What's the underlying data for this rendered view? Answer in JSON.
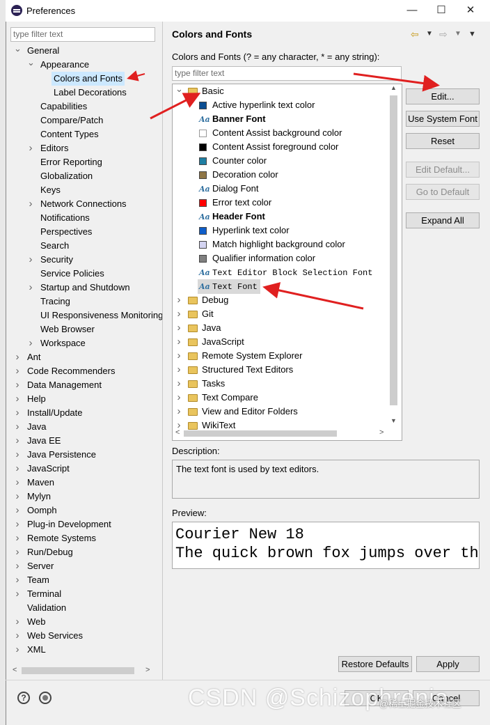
{
  "window": {
    "title": "Preferences",
    "minimize": "—",
    "maximize": "☐",
    "close": "✕"
  },
  "left": {
    "filter_placeholder": "type filter text",
    "tree": [
      {
        "label": "General",
        "level": 0,
        "arrow": "down"
      },
      {
        "label": "Appearance",
        "level": 1,
        "arrow": "down"
      },
      {
        "label": "Colors and Fonts",
        "level": 2,
        "arrow": "",
        "selected": true
      },
      {
        "label": "Label Decorations",
        "level": 2,
        "arrow": ""
      },
      {
        "label": "Capabilities",
        "level": 1,
        "arrow": ""
      },
      {
        "label": "Compare/Patch",
        "level": 1,
        "arrow": ""
      },
      {
        "label": "Content Types",
        "level": 1,
        "arrow": ""
      },
      {
        "label": "Editors",
        "level": 1,
        "arrow": "right"
      },
      {
        "label": "Error Reporting",
        "level": 1,
        "arrow": ""
      },
      {
        "label": "Globalization",
        "level": 1,
        "arrow": ""
      },
      {
        "label": "Keys",
        "level": 1,
        "arrow": ""
      },
      {
        "label": "Network Connections",
        "level": 1,
        "arrow": "right"
      },
      {
        "label": "Notifications",
        "level": 1,
        "arrow": ""
      },
      {
        "label": "Perspectives",
        "level": 1,
        "arrow": ""
      },
      {
        "label": "Search",
        "level": 1,
        "arrow": ""
      },
      {
        "label": "Security",
        "level": 1,
        "arrow": "right"
      },
      {
        "label": "Service Policies",
        "level": 1,
        "arrow": ""
      },
      {
        "label": "Startup and Shutdown",
        "level": 1,
        "arrow": "right"
      },
      {
        "label": "Tracing",
        "level": 1,
        "arrow": ""
      },
      {
        "label": "UI Responsiveness Monitoring",
        "level": 1,
        "arrow": ""
      },
      {
        "label": "Web Browser",
        "level": 1,
        "arrow": ""
      },
      {
        "label": "Workspace",
        "level": 1,
        "arrow": "right"
      },
      {
        "label": "Ant",
        "level": 0,
        "arrow": "right"
      },
      {
        "label": "Code Recommenders",
        "level": 0,
        "arrow": "right"
      },
      {
        "label": "Data Management",
        "level": 0,
        "arrow": "right"
      },
      {
        "label": "Help",
        "level": 0,
        "arrow": "right"
      },
      {
        "label": "Install/Update",
        "level": 0,
        "arrow": "right"
      },
      {
        "label": "Java",
        "level": 0,
        "arrow": "right"
      },
      {
        "label": "Java EE",
        "level": 0,
        "arrow": "right"
      },
      {
        "label": "Java Persistence",
        "level": 0,
        "arrow": "right"
      },
      {
        "label": "JavaScript",
        "level": 0,
        "arrow": "right"
      },
      {
        "label": "Maven",
        "level": 0,
        "arrow": "right"
      },
      {
        "label": "Mylyn",
        "level": 0,
        "arrow": "right"
      },
      {
        "label": "Oomph",
        "level": 0,
        "arrow": "right"
      },
      {
        "label": "Plug-in Development",
        "level": 0,
        "arrow": "right"
      },
      {
        "label": "Remote Systems",
        "level": 0,
        "arrow": "right"
      },
      {
        "label": "Run/Debug",
        "level": 0,
        "arrow": "right"
      },
      {
        "label": "Server",
        "level": 0,
        "arrow": "right"
      },
      {
        "label": "Team",
        "level": 0,
        "arrow": "right"
      },
      {
        "label": "Terminal",
        "level": 0,
        "arrow": "right"
      },
      {
        "label": "Validation",
        "level": 0,
        "arrow": ""
      },
      {
        "label": "Web",
        "level": 0,
        "arrow": "right"
      },
      {
        "label": "Web Services",
        "level": 0,
        "arrow": "right"
      },
      {
        "label": "XML",
        "level": 0,
        "arrow": "right"
      }
    ]
  },
  "right": {
    "title": "Colors and Fonts",
    "hint": "Colors and Fonts (? = any character, * = any string):",
    "filter_placeholder": "type filter text",
    "tree": [
      {
        "label": "Basic",
        "kind": "folder",
        "level": 0,
        "arrow": "down"
      },
      {
        "label": "Active hyperlink text color",
        "kind": "color",
        "color": "#0b4d91",
        "level": 1
      },
      {
        "label": "Banner Font",
        "kind": "font",
        "bold": true,
        "level": 1
      },
      {
        "label": "Content Assist background color",
        "kind": "color",
        "color": "#ffffff",
        "level": 1
      },
      {
        "label": "Content Assist foreground color",
        "kind": "color",
        "color": "#000000",
        "level": 1
      },
      {
        "label": "Counter color",
        "kind": "color",
        "color": "#1f7fa3",
        "level": 1
      },
      {
        "label": "Decoration color",
        "kind": "color",
        "color": "#8f7646",
        "level": 1
      },
      {
        "label": "Dialog Font",
        "kind": "font",
        "level": 1
      },
      {
        "label": "Error text color",
        "kind": "color",
        "color": "#ff0000",
        "level": 1
      },
      {
        "label": "Header Font",
        "kind": "font",
        "bold": true,
        "level": 1
      },
      {
        "label": "Hyperlink text color",
        "kind": "color",
        "color": "#0f5ec9",
        "level": 1
      },
      {
        "label": "Match highlight background color",
        "kind": "color",
        "color": "#d4d4f2",
        "level": 1
      },
      {
        "label": "Qualifier information color",
        "kind": "color",
        "color": "#808080",
        "level": 1
      },
      {
        "label": "Text Editor Block Selection Font",
        "kind": "font",
        "mono": true,
        "level": 1
      },
      {
        "label": "Text Font",
        "kind": "font",
        "mono": true,
        "level": 1,
        "selected": true
      },
      {
        "label": "Debug",
        "kind": "folder",
        "level": 0,
        "arrow": "right"
      },
      {
        "label": "Git",
        "kind": "folder",
        "level": 0,
        "arrow": "right"
      },
      {
        "label": "Java",
        "kind": "folder",
        "level": 0,
        "arrow": "right"
      },
      {
        "label": "JavaScript",
        "kind": "folder",
        "level": 0,
        "arrow": "right"
      },
      {
        "label": "Remote System Explorer",
        "kind": "folder",
        "level": 0,
        "arrow": "right"
      },
      {
        "label": "Structured Text Editors",
        "kind": "folder",
        "level": 0,
        "arrow": "right"
      },
      {
        "label": "Tasks",
        "kind": "folder",
        "level": 0,
        "arrow": "right"
      },
      {
        "label": "Text Compare",
        "kind": "folder",
        "level": 0,
        "arrow": "right"
      },
      {
        "label": "View and Editor Folders",
        "kind": "folder",
        "level": 0,
        "arrow": "right"
      },
      {
        "label": "WikiText",
        "kind": "folder",
        "level": 0,
        "arrow": "right"
      }
    ],
    "buttons": {
      "edit": "Edit...",
      "use_system_font": "Use System Font",
      "reset": "Reset",
      "edit_default": "Edit Default...",
      "go_to_default": "Go to Default",
      "expand_all": "Expand All"
    },
    "description_label": "Description:",
    "description": "The text font is used by text editors.",
    "preview_label": "Preview:",
    "preview_line1": "Courier New 18",
    "preview_line2": "The quick brown fox jumps over the lazy dog.",
    "restore_defaults": "Restore Defaults",
    "apply": "Apply"
  },
  "footer": {
    "help_icon": "?",
    "ok": "OK",
    "cancel": "Cancel"
  },
  "watermark": {
    "main": "CSDN @Schizophrenia",
    "sub": "@稀土掘金技术社区"
  },
  "colors": {
    "selection": "#cce8ff",
    "annotation_arrow": "#e02020"
  }
}
